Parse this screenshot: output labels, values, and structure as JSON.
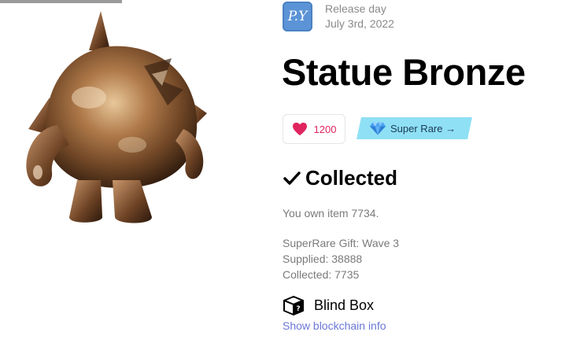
{
  "creator": {
    "avatar_initials": "P.Y",
    "release_label": "Release day",
    "release_date": "July 3rd, 2022"
  },
  "item": {
    "title": "Statue Bronze",
    "likes": "1200",
    "rarity_label": "Super Rare →",
    "collected_label": "Collected",
    "owned_text": "You own item 7734.",
    "stats": [
      "SuperRare Gift: Wave 3",
      "Supplied: 38888",
      "Collected: 7735"
    ],
    "blind_box_label": "Blind Box",
    "blockchain_link": "Show blockchain info"
  },
  "colors": {
    "heart": "#e0245e",
    "rarity_bg": "#8fe0f5",
    "link": "#6b77d8",
    "avatar_bg": "#5b93d6"
  },
  "icons": [
    "heart-icon",
    "diamond-icon",
    "checkmark-icon",
    "mystery-box-icon"
  ]
}
